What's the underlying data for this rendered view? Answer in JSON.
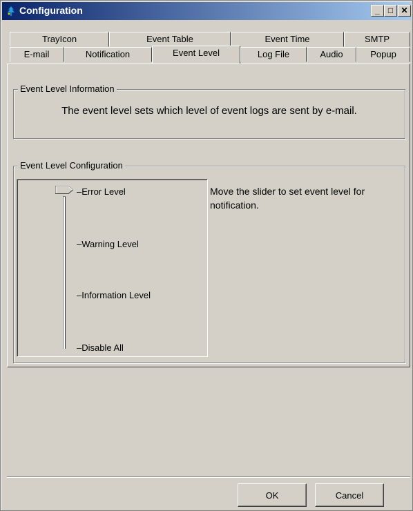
{
  "window": {
    "title": "Configuration",
    "minimize_glyph": "_",
    "maximize_glyph": "□",
    "close_glyph": "✕"
  },
  "tabs": {
    "row_top": [
      {
        "label": "TrayIcon"
      },
      {
        "label": "Event Table"
      },
      {
        "label": "Event Time"
      },
      {
        "label": "SMTP"
      }
    ],
    "row_bottom": [
      {
        "label": "E-mail"
      },
      {
        "label": "Notification"
      },
      {
        "label": "Event Level",
        "selected": true
      },
      {
        "label": "Log File"
      },
      {
        "label": "Audio"
      },
      {
        "label": "Popup"
      }
    ]
  },
  "info_group": {
    "legend": "Event Level Information",
    "text": "The event level sets which level of event logs are sent by e-mail."
  },
  "config_group": {
    "legend": "Event Level Configuration",
    "description": "Move the slider to set event level for notification.",
    "levels": [
      {
        "label": "Error Level"
      },
      {
        "label": "Warning Level"
      },
      {
        "label": "Information Level"
      },
      {
        "label": "Disable All"
      }
    ],
    "selected_level": "Error Level"
  },
  "buttons": {
    "ok": "OK",
    "cancel": "Cancel"
  },
  "colors": {
    "titlebar_start": "#0a246a",
    "titlebar_end": "#a6caf0",
    "face": "#d4d0c8"
  }
}
